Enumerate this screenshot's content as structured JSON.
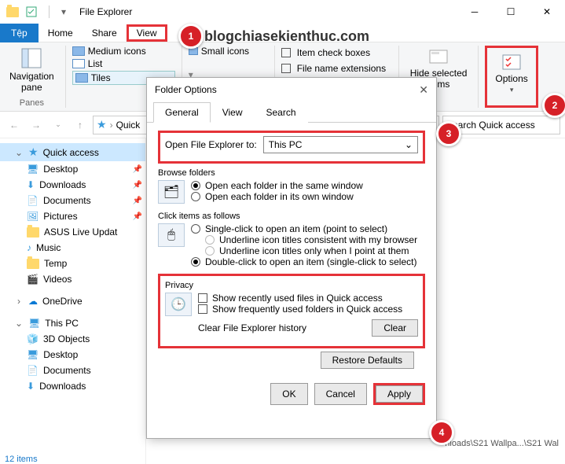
{
  "titlebar": {
    "app_title": "File Explorer"
  },
  "menubar": {
    "file": "Tệp",
    "home": "Home",
    "share": "Share",
    "view": "View"
  },
  "watermark": "blogchiasekienthuc.com",
  "ribbon": {
    "nav_pane": "Navigation\npane",
    "panes_label": "Panes",
    "medium_icons": "Medium icons",
    "small_icons": "Small icons",
    "list": "List",
    "tiles": "Tiles",
    "item_checkboxes": "Item check boxes",
    "file_ext": "File name extensions",
    "hide_selected": "Hide selected\nitems",
    "options": "Options"
  },
  "address": {
    "crumb1": "Quick",
    "search_placeholder": "Search Quick access"
  },
  "sidebar": {
    "quick_access": "Quick access",
    "desktop": "Desktop",
    "downloads": "Downloads",
    "documents": "Documents",
    "pictures": "Pictures",
    "asus": "ASUS Live Updat",
    "music": "Music",
    "temp": "Temp",
    "videos": "Videos",
    "onedrive": "OneDrive",
    "thispc": "This PC",
    "3dobjects": "3D Objects",
    "desktop2": "Desktop",
    "documents2": "Documents",
    "downloads2": "Downloads"
  },
  "status": {
    "items": "12 items"
  },
  "pathbit": "nloads\\S21 Wallpa...\\S21 Wal",
  "dialog": {
    "title": "Folder Options",
    "tabs": {
      "general": "General",
      "view": "View",
      "search": "Search"
    },
    "open_to_label": "Open File Explorer to:",
    "open_to_value": "This PC",
    "browse_title": "Browse folders",
    "browse_same": "Open each folder in the same window",
    "browse_own": "Open each folder in its own window",
    "click_title": "Click items as follows",
    "single_click": "Single-click to open an item (point to select)",
    "underline_browser": "Underline icon titles consistent with my browser",
    "underline_point": "Underline icon titles only when I point at them",
    "double_click": "Double-click to open an item (single-click to select)",
    "privacy_title": "Privacy",
    "show_recent": "Show recently used files in Quick access",
    "show_freq": "Show frequently used folders in Quick access",
    "clear_label": "Clear File Explorer history",
    "clear_btn": "Clear",
    "restore": "Restore Defaults",
    "ok": "OK",
    "cancel": "Cancel",
    "apply": "Apply"
  },
  "badges": {
    "b1": "1",
    "b2": "2",
    "b3": "3",
    "b4": "4"
  }
}
